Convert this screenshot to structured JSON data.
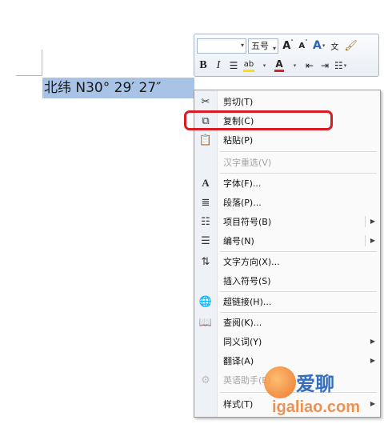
{
  "document": {
    "selected_text": "北纬 N30° 29′ 27″"
  },
  "mini_toolbar": {
    "font_name": "",
    "font_size": "五号",
    "grow_font": "A",
    "shrink_font": "A",
    "bold": "B",
    "italic": "I",
    "font_color_letter": "A",
    "colors": {
      "highlight": "#ffe000",
      "font_color": "#e02020"
    }
  },
  "context_menu": {
    "items": [
      {
        "label": "剪切(T)",
        "icon": "scissors-icon",
        "disabled": false,
        "submenu": false
      },
      {
        "label": "复制(C)",
        "icon": "copy-icon",
        "disabled": false,
        "submenu": false
      },
      {
        "label": "粘贴(P)",
        "icon": "paste-icon",
        "disabled": false,
        "submenu": false
      },
      {
        "label": "汉字重选(V)",
        "icon": "",
        "disabled": true,
        "submenu": false
      },
      {
        "label": "字体(F)...",
        "icon": "font-icon",
        "disabled": false,
        "submenu": false
      },
      {
        "label": "段落(P)...",
        "icon": "paragraph-icon",
        "disabled": false,
        "submenu": false
      },
      {
        "label": "项目符号(B)",
        "icon": "bullets-icon",
        "disabled": false,
        "submenu": true
      },
      {
        "label": "编号(N)",
        "icon": "numbering-icon",
        "disabled": false,
        "submenu": true
      },
      {
        "label": "文字方向(X)...",
        "icon": "text-direction-icon",
        "disabled": false,
        "submenu": false
      },
      {
        "label": "插入符号(S)",
        "icon": "",
        "disabled": false,
        "submenu": false
      },
      {
        "label": "超链接(H)...",
        "icon": "hyperlink-icon",
        "disabled": false,
        "submenu": false
      },
      {
        "label": "查阅(K)...",
        "icon": "lookup-icon",
        "disabled": false,
        "submenu": false
      },
      {
        "label": "同义词(Y)",
        "icon": "",
        "disabled": false,
        "submenu": true
      },
      {
        "label": "翻译(A)",
        "icon": "",
        "disabled": false,
        "submenu": true
      },
      {
        "label": "英语助手(E)",
        "icon": "assistant-icon",
        "disabled": true,
        "submenu": false
      },
      {
        "label": "样式(T)",
        "icon": "",
        "disabled": false,
        "submenu": true
      }
    ],
    "highlight_color": "#d91b24"
  },
  "watermark": {
    "title": "爱聊",
    "url": "igaliao.com"
  }
}
